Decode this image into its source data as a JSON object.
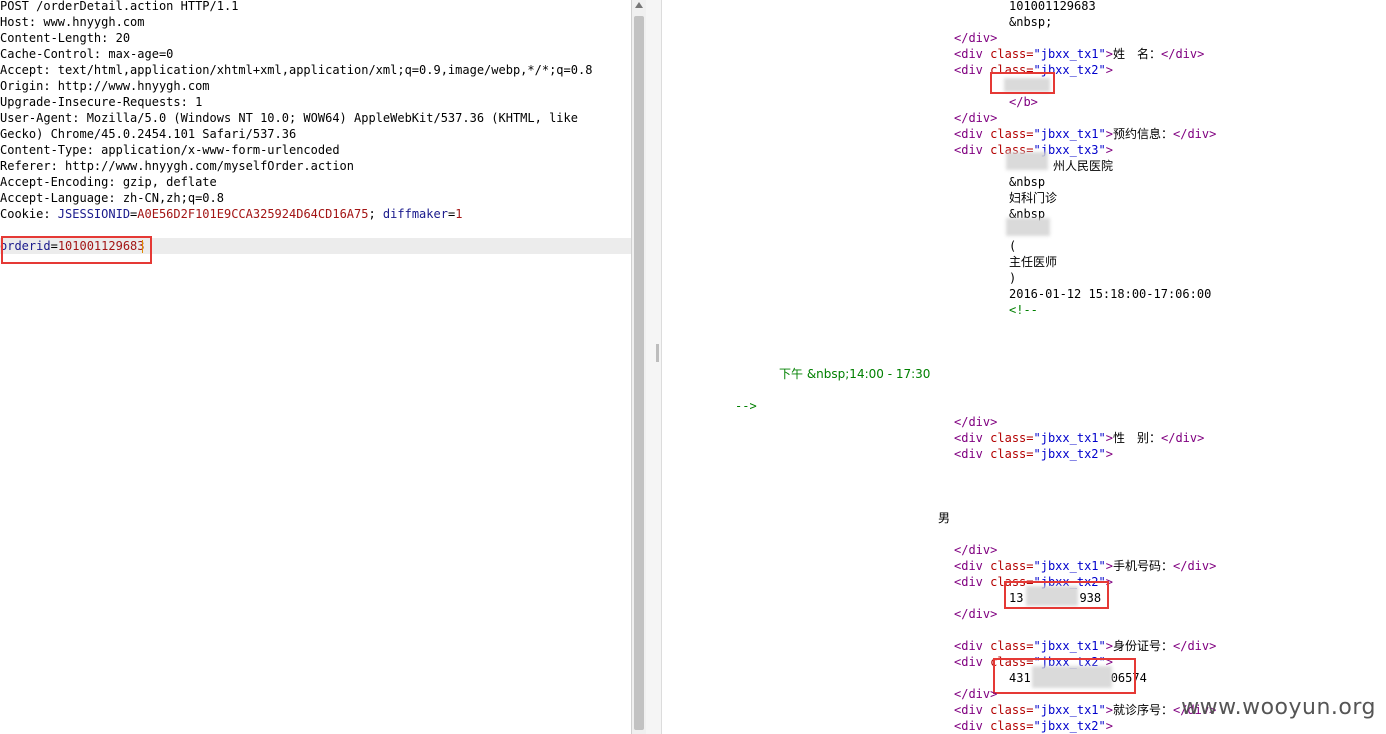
{
  "request": {
    "header_lines": [
      {
        "text": "POST /orderDetail.action HTTP/1.1"
      },
      {
        "text": "Host: www.hnyygh.com"
      },
      {
        "text": "Content-Length: 20"
      },
      {
        "text": "Cache-Control: max-age=0"
      },
      {
        "text": "Accept: text/html,application/xhtml+xml,application/xml;q=0.9,image/webp,*/*;q=0.8"
      },
      {
        "text": "Origin: http://www.hnyygh.com"
      },
      {
        "text": "Upgrade-Insecure-Requests: 1"
      },
      {
        "text": "User-Agent: Mozilla/5.0 (Windows NT 10.0; WOW64) AppleWebKit/537.36 (KHTML, like"
      },
      {
        "text": "Gecko) Chrome/45.0.2454.101 Safari/537.36"
      },
      {
        "text": "Content-Type: application/x-www-form-urlencoded"
      },
      {
        "text": "Referer: http://www.hnyygh.com/myselfOrder.action"
      },
      {
        "text": "Accept-Encoding: gzip, deflate"
      },
      {
        "text": "Accept-Language: zh-CN,zh;q=0.8"
      }
    ],
    "cookie": {
      "label": "Cookie: ",
      "k1": "JSESSIONID",
      "v1": "A0E56D2F101E9CCA325924D64CD16A75",
      "sep": "; ",
      "k2": "diffmaker",
      "v2": "1"
    },
    "body": {
      "key": "orderid",
      "eq": "=",
      "value": "101001129683"
    }
  },
  "response": {
    "orderid_text": "101001129683",
    "nbsp": "&nbsp;",
    "nbsp_short": "&nbsp",
    "div_close": "</div>",
    "div_open": "<div",
    "gt": ">",
    "class_attr": "class=",
    "q_tx1": "\"jbxx_tx1\"",
    "q_tx2": "\"jbxx_tx2\"",
    "q_tx3": "\"jbxx_tx3\"",
    "b_close": "</b>",
    "label_name": "姓　名：",
    "label_booking": "预约信息：",
    "hospital_partial": "州人民医院",
    "dept": "妇科门诊",
    "paren_open": "(",
    "doctor_title": "主任医师",
    "paren_close": ")",
    "datetime": "2016-01-12 15:18:00-17:06:00",
    "comment_open": "<!--",
    "comment_line": "下午 &nbsp;14:00 - 17:30",
    "comment_close": "-->",
    "label_gender": "性　别：",
    "gender": "男",
    "label_phone": "手机号码：",
    "phone_prefix": "13",
    "phone_suffix": "938",
    "label_id": "身份证号：",
    "id_prefix": "431",
    "id_suffix": "06574",
    "label_seq": "就诊序号："
  },
  "watermark": "www.wooyun.org"
}
